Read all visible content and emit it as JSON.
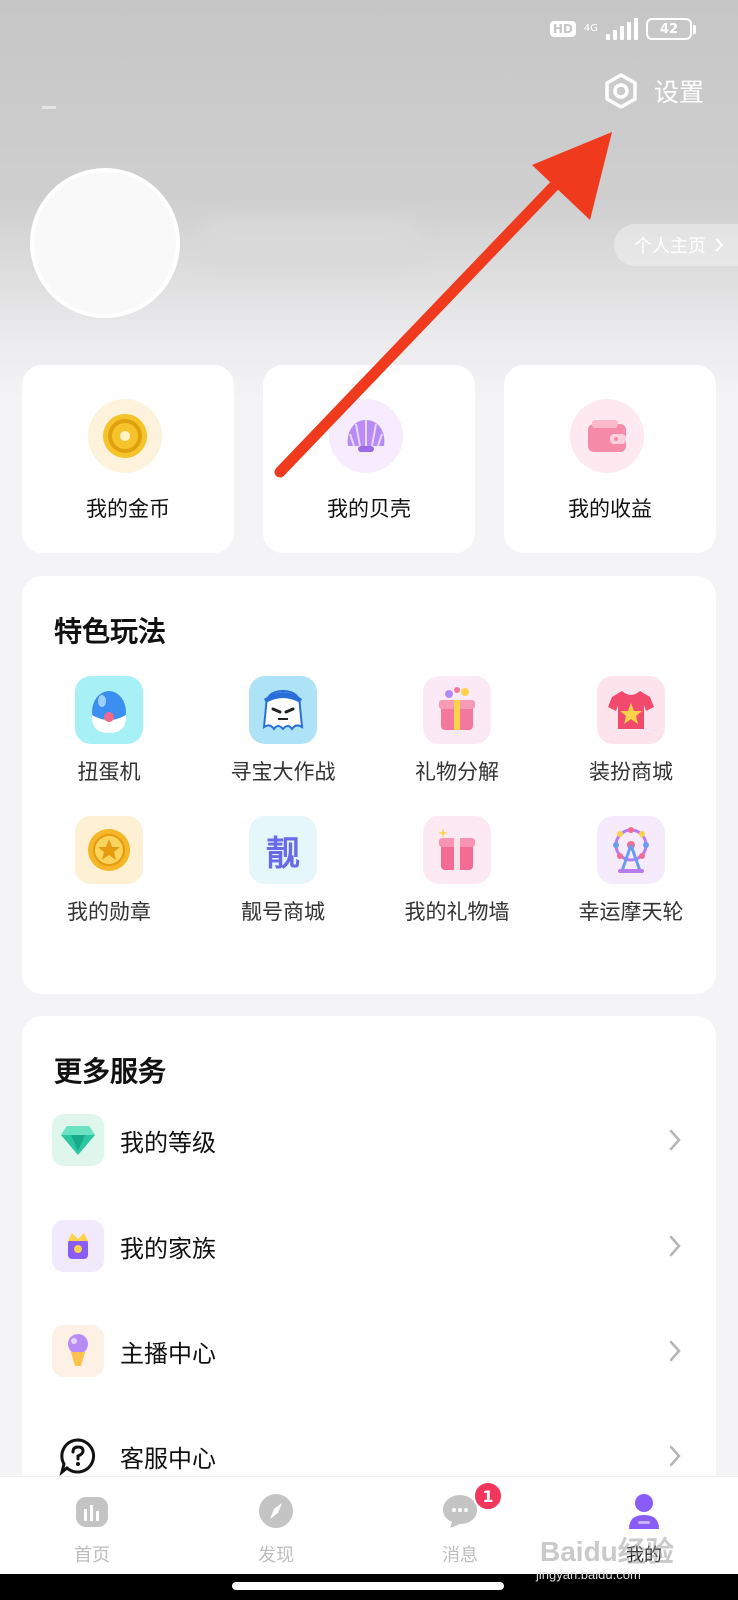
{
  "status_bar": {
    "hd": "HD",
    "network": "4G",
    "battery": "42"
  },
  "header": {
    "settings_label": "设置",
    "homepage_link": "个人主页"
  },
  "quick_cards": [
    {
      "label": "我的金币",
      "icon": "gold-coin-icon"
    },
    {
      "label": "我的贝壳",
      "icon": "shell-icon"
    },
    {
      "label": "我的收益",
      "icon": "wallet-icon"
    }
  ],
  "features": {
    "title": "特色玩法",
    "items": [
      {
        "label": "扭蛋机",
        "icon": "capsule-egg-icon"
      },
      {
        "label": "寻宝大作战",
        "icon": "ghost-pirate-icon"
      },
      {
        "label": "礼物分解",
        "icon": "gift-box-icon"
      },
      {
        "label": "装扮商城",
        "icon": "tshirt-star-icon"
      },
      {
        "label": "我的勋章",
        "icon": "medal-star-icon"
      },
      {
        "label": "靓号商城",
        "icon": "liang-char-icon",
        "glyph": "靓"
      },
      {
        "label": "我的礼物墙",
        "icon": "gift-wall-icon"
      },
      {
        "label": "幸运摩天轮",
        "icon": "ferris-wheel-icon"
      }
    ]
  },
  "services": {
    "title": "更多服务",
    "items": [
      {
        "label": "我的等级",
        "icon": "diamond-level-icon"
      },
      {
        "label": "我的家族",
        "icon": "family-crown-icon"
      },
      {
        "label": "主播中心",
        "icon": "microphone-icon"
      },
      {
        "label": "客服中心",
        "icon": "help-chat-icon"
      }
    ]
  },
  "tabbar": {
    "items": [
      {
        "label": "首页",
        "icon": "home-bars-icon"
      },
      {
        "label": "发现",
        "icon": "compass-icon"
      },
      {
        "label": "消息",
        "icon": "chat-bubble-icon",
        "badge": "1"
      },
      {
        "label": "我的",
        "icon": "profile-icon",
        "active": true
      }
    ]
  },
  "watermark": {
    "brand": "Baidu经验",
    "url": "jingyan.baidu.com"
  },
  "colors": {
    "accent_purple": "#8a5cf6",
    "arrow_red": "#f03a1e",
    "badge_red": "#f5365c"
  }
}
